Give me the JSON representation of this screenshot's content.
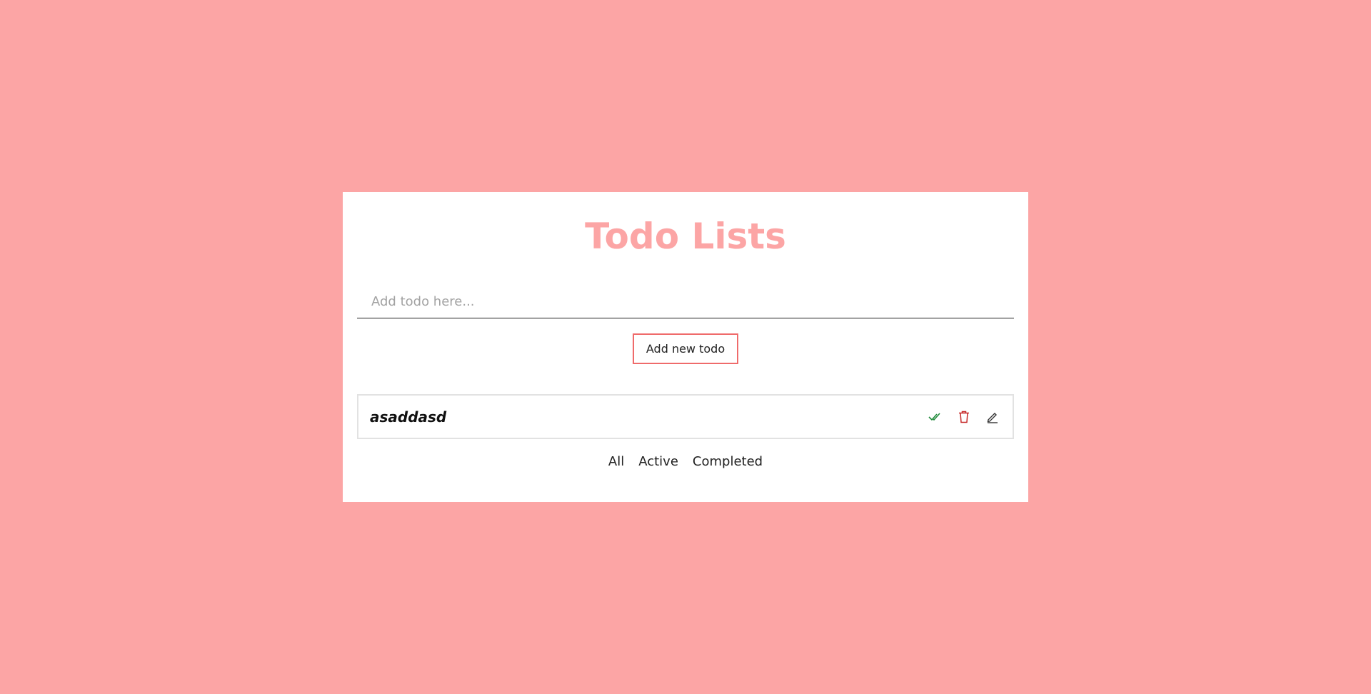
{
  "app": {
    "title": "Todo Lists"
  },
  "form": {
    "input_value": "",
    "input_placeholder": "Add todo here...",
    "add_label": "Add new todo"
  },
  "todos": [
    {
      "text": "asaddasd",
      "actions": [
        "complete-icon",
        "trash-icon",
        "pencil-icon"
      ]
    }
  ],
  "filters": {
    "all": "All",
    "active": "Active",
    "completed": "Completed"
  },
  "colors": {
    "background": "#fca5a5",
    "title": "#fca5a5",
    "button_border": "#ef6b6b",
    "complete_icon": "#1f8a3a",
    "delete_icon": "#c62828",
    "edit_icon": "#333333"
  }
}
